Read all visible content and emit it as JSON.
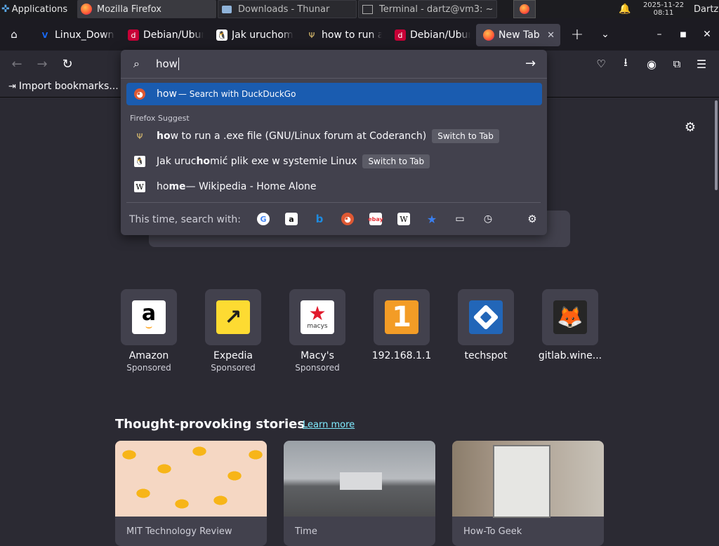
{
  "panel": {
    "applications_label": "Applications",
    "tasks": [
      {
        "label": "Mozilla Firefox"
      },
      {
        "label": "Downloads - Thunar"
      },
      {
        "label": "Terminal - dartz@vm3: ~"
      }
    ],
    "clock_date": "2025-11-22",
    "clock_time": "08:11",
    "user": "Dartz"
  },
  "tabs": [
    {
      "title": "Linux_Downloads",
      "icon": "vagrant-icon"
    },
    {
      "title": "Debian/Ubuntu",
      "icon": "debian-icon"
    },
    {
      "title": "Jak uruchomić",
      "icon": "tux-icon"
    },
    {
      "title": "how to run a .exe",
      "icon": "coderanch-icon"
    },
    {
      "title": "Debian/Ubuntu",
      "icon": "debian-icon"
    },
    {
      "title": "New Tab",
      "icon": "firefox-icon"
    }
  ],
  "bookmarks": {
    "import_label": "Import bookmarks..."
  },
  "urlbar": {
    "value": "how",
    "suggestion_primary": {
      "bold": "how",
      "text": " — Search with DuckDuckGo"
    },
    "section_label": "Firefox Suggest",
    "suggestions": [
      {
        "pre": "",
        "bold": "ho",
        "post": "w to run a .exe file (GNU/Linux forum at Coderanch)",
        "button": "Switch to Tab"
      },
      {
        "pre": "Jak uruc",
        "bold": "ho",
        "post": "mić plik exe w systemie Linux",
        "button": "Switch to Tab"
      },
      {
        "pre": "ho",
        "bold": "me",
        "post": " — Wikipedia - Home Alone",
        "button": ""
      }
    ],
    "search_with_label": "This time, search with:",
    "engines": [
      "google-icon",
      "amazon-icon",
      "bing-icon",
      "duckduckgo-icon",
      "ebay-icon",
      "wikipedia-icon",
      "bookmarks-icon",
      "tabs-icon",
      "history-icon"
    ]
  },
  "topsites": [
    {
      "label": "Amazon",
      "sub": "Sponsored",
      "bg": "#ffffff"
    },
    {
      "label": "Expedia",
      "sub": "Sponsored",
      "bg": "#fddb32"
    },
    {
      "label": "Macy's",
      "sub": "Sponsored",
      "bg": "#ffffff"
    },
    {
      "label": "192.168.1.1",
      "sub": "",
      "bg": "#f39c26"
    },
    {
      "label": "techspot",
      "sub": "",
      "bg": "#2266b8"
    },
    {
      "label": "gitlab.wine...",
      "sub": "",
      "bg": "#262626"
    }
  ],
  "stories": {
    "heading": "Thought-provoking stories",
    "learn_more": "Learn more",
    "cards": [
      {
        "source": "MIT Technology Review"
      },
      {
        "source": "Time"
      },
      {
        "source": "How-To Geek"
      }
    ]
  },
  "colors": {
    "accent": "#1a5cb0",
    "link": "#80ebff",
    "bg": "#2b2a33"
  }
}
